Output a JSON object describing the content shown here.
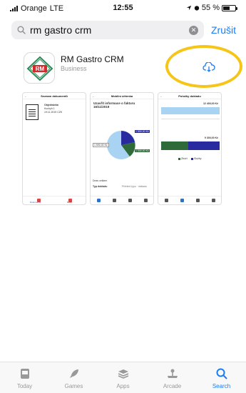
{
  "status_bar": {
    "carrier": "Orange",
    "network": "LTE",
    "time": "12:55",
    "battery": "55 %"
  },
  "search": {
    "query": "rm gastro crm",
    "cancel_label": "Zrušit"
  },
  "app": {
    "name": "RM Gastro CRM",
    "category": "Business",
    "icon_text": "RM"
  },
  "screenshots": [
    {
      "title": "Seznam dokumentů",
      "doc_line1": "Objednávka",
      "doc_line2": "Kuchyň 1",
      "doc_line3": "19.11.2019 CZK",
      "tabs": [
        "Dokumenty",
        "Nový"
      ]
    },
    {
      "title": "Mobilní účtenka",
      "header": "Uzavřít informace o fakturu 16/11/2019",
      "slice_a": "1 500,00 Kč",
      "slice_b": "1 500,00 Kč",
      "slice_c": "1 500,00 Kč",
      "row1": "Dnes celkem",
      "row2": "Typ dokladu",
      "row2_value": "Přehled typu · dokladu"
    },
    {
      "title": "Položky dokladu",
      "value_top": "12 400,00 Kč",
      "value_bottom": "9 300,00 Kč",
      "legend_a": "Zboží",
      "legend_b": "Služby"
    }
  ],
  "colors": {
    "accent": "#1a7cf5",
    "highlight": "#f5c518",
    "pie_light": "#a9d3f2",
    "pie_navy": "#2a2aa0",
    "pie_green": "#2e6b38"
  },
  "tabbar": [
    {
      "label": "Today",
      "icon": "today-icon"
    },
    {
      "label": "Games",
      "icon": "rocket-icon"
    },
    {
      "label": "Apps",
      "icon": "layers-icon"
    },
    {
      "label": "Arcade",
      "icon": "joystick-icon"
    },
    {
      "label": "Search",
      "icon": "search-icon",
      "active": true
    }
  ]
}
